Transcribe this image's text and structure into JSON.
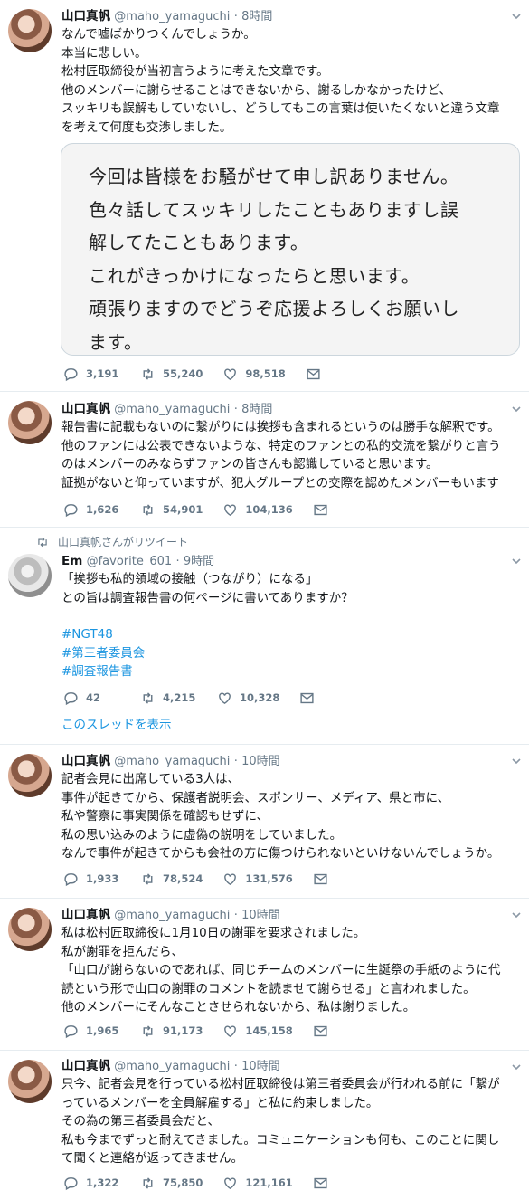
{
  "tweets": [
    {
      "name": "山口真帆",
      "handle": "@maho_yamaguchi",
      "time": "8時間",
      "lines": [
        "なんで嘘ばかりつくんでしょうか。",
        "本当に悲しい。",
        "松村匠取締役が当初言うように考えた文章です。",
        "他のメンバーに謝らせることはできないから、謝るしかなかったけど、",
        "スッキリも誤解もしていないし、どうしてもこの言葉は使いたくないと違う文章",
        "を考えて何度も交渉しました。"
      ],
      "image_lines": [
        "今回は皆様をお騒がせて申し訳ありません。",
        "色々話してスッキリしたこともありますし誤",
        "解してたこともあります。",
        "これがきっかけになったらと思います。",
        "頑張りますのでどうぞ応援よろしくお願いし",
        "ます。"
      ],
      "replies": "3,191",
      "retweets": "55,240",
      "likes": "98,518"
    },
    {
      "name": "山口真帆",
      "handle": "@maho_yamaguchi",
      "time": "8時間",
      "lines": [
        "報告書に記載もないのに繋がりには挨拶も含まれるというのは勝手な解釈です。",
        "他のファンには公表できないような、特定のファンとの私的交流を繋がりと言う",
        "のはメンバーのみならずファンの皆さんも認識していると思います。",
        "証拠がないと仰っていますが、犯人グループとの交際を認めたメンバーもいます"
      ],
      "replies": "1,626",
      "retweets": "54,901",
      "likes": "104,136"
    },
    {
      "retweeted_by": "山口真帆さんがリツイート",
      "name": "Em",
      "handle": "@favorite_601",
      "time": "9時間",
      "lines": [
        "「挨拶も私的領域の接触（つながり）になる」",
        "との旨は調査報告書の何ページに書いてありますか？"
      ],
      "hashtags": [
        "#NGT48",
        "#第三者委員会",
        "#調査報告書"
      ],
      "replies": "42",
      "retweets": "4,215",
      "likes": "10,328",
      "thread_link": "このスレッドを表示"
    },
    {
      "name": "山口真帆",
      "handle": "@maho_yamaguchi",
      "time": "10時間",
      "lines": [
        "記者会見に出席している3人は、",
        "事件が起きてから、保護者説明会、スポンサー、メディア、県と市に、",
        "私や警察に事実関係を確認もせずに、",
        "私の思い込みのように虚偽の説明をしていました。",
        "なんで事件が起きてからも会社の方に傷つけられないといけないんでしょうか。"
      ],
      "replies": "1,933",
      "retweets": "78,524",
      "likes": "131,576"
    },
    {
      "name": "山口真帆",
      "handle": "@maho_yamaguchi",
      "time": "10時間",
      "lines": [
        "私は松村匠取締役に1月10日の謝罪を要求されました。",
        "私が謝罪を拒んだら、",
        "「山口が謝らないのであれば、同じチームのメンバーに生誕祭の手紙のように代",
        "読という形で山口の謝罪のコメントを読ませて謝らせる」と言われました。",
        "他のメンバーにそんなことさせられないから、私は謝りました。"
      ],
      "replies": "1,965",
      "retweets": "91,173",
      "likes": "145,158"
    },
    {
      "name": "山口真帆",
      "handle": "@maho_yamaguchi",
      "time": "10時間",
      "lines": [
        "只今、記者会見を行っている松村匠取締役は第三者委員会が行われる前に「繋が",
        "っているメンバーを全員解雇する」と私に約束しました。",
        "その為の第三者委員会だと、",
        "私も今までずっと耐えてきました。コミュニケーションも何も、このことに関し",
        "て聞くと連絡が返ってきません。"
      ],
      "replies": "1,322",
      "retweets": "75,850",
      "likes": "121,161"
    }
  ],
  "dot": "·"
}
